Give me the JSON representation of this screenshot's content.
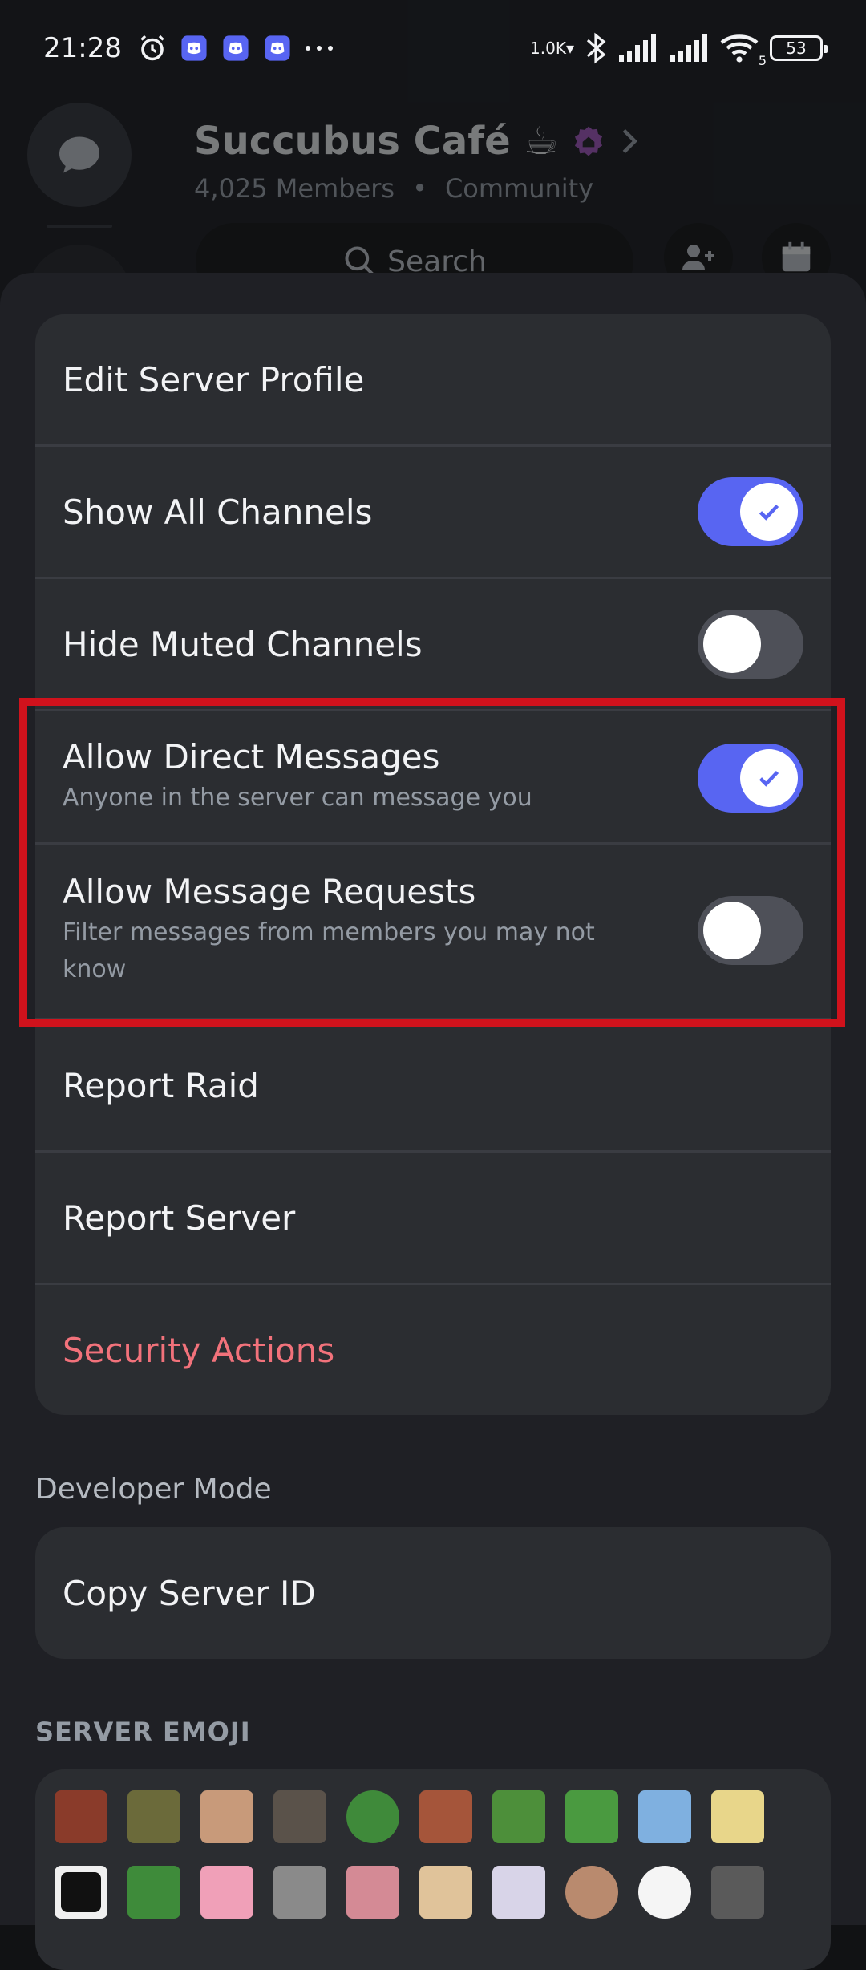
{
  "status_bar": {
    "time": "21:28",
    "net_speed": "1.0K▾",
    "wifi_badge": "5",
    "battery": "53"
  },
  "server": {
    "name": "Succubus Café ☕",
    "members": "4,025 Members",
    "separator": "•",
    "tag": "Community",
    "search_placeholder": "Search"
  },
  "menu": {
    "edit_profile": "Edit Server Profile",
    "show_all_channels": {
      "label": "Show All Channels",
      "enabled": true
    },
    "hide_muted_channels": {
      "label": "Hide Muted Channels",
      "enabled": false
    },
    "allow_dms": {
      "label": "Allow Direct Messages",
      "sub": "Anyone in the server can message you",
      "enabled": true
    },
    "allow_requests": {
      "label": "Allow Message Requests",
      "sub": "Filter messages from members you may not know",
      "enabled": false
    },
    "report_raid": "Report Raid",
    "report_server": "Report Server",
    "security_actions": "Security Actions"
  },
  "developer": {
    "section": "Developer Mode",
    "copy_id": "Copy Server ID"
  },
  "emoji": {
    "section": "SERVER EMOJI",
    "items": [
      "laughing-man-emoji",
      "frog-puppet-emoji",
      "grinning-man-emoji",
      "cat-emoji",
      "pepe-smile-emoji",
      "shocked-man-emoji",
      "pepe-cry-emoji",
      "pepe-happy-emoji",
      "anime-blue-hair-emoji",
      "anime-blonde-emoji",
      "trollface-emoji",
      "pepe-sunglasses-emoji",
      "pink-hair-heart-emoji",
      "long-hair-face-emoji",
      "pink-hair-anime-emoji",
      "catgirl-emoji",
      "white-hair-anime-emoji",
      "bald-head-emoji",
      "troll-grin-emoji",
      "chad-emoji"
    ]
  },
  "colors": {
    "accent": "#5865f2",
    "danger": "#f2727b",
    "highlight_box": "#d0121c",
    "card": "#2b2d31",
    "sheet": "#1f2025"
  }
}
